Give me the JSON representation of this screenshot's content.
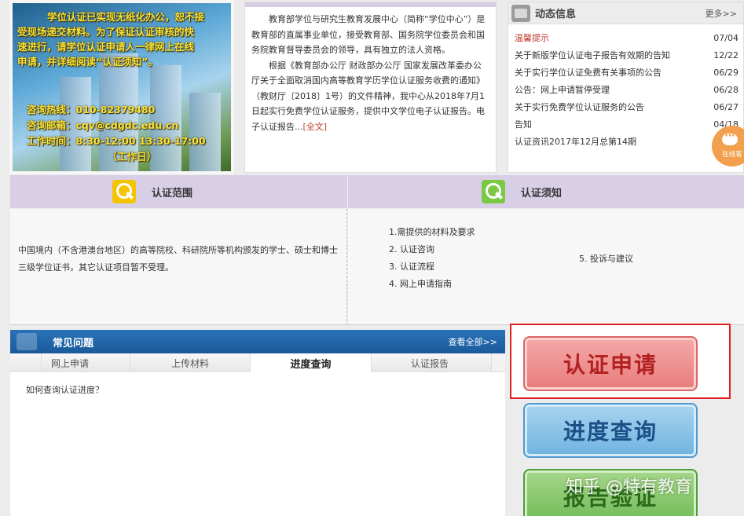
{
  "banner": {
    "line1": "学位认证已实现无纸化办公，恕不接",
    "line2": "受现场递交材料。为了保证认证审核的快",
    "line3": "速进行，请学位认证申请人一律网上在线",
    "line4": "申请，并详细阅读“认证须知”。",
    "hotline": "咨询热线：010-82379480",
    "email": "咨询邮箱：cqv@cdgdc.edu.cn",
    "hours": "工作时间：8:30-12:00  13:30-17:00",
    "workday": "（工作日）"
  },
  "intro": {
    "para1": "教育部学位与研究生教育发展中心（简称“学位中心”）是教育部的直属事业单位，接受教育部、国务院学位委员会和国务院教育督导委员会的领导，具有独立的法人资格。",
    "para2": "根据《教育部办公厅 财政部办公厅 国家发展改革委办公厅关于全面取消国内高等教育学历学位认证服务收费的通知》（教财厅〔2018〕1号）的文件精神，我中心从2018年7月1日起实行免费学位认证服务，提供中文学位电子认证报告。电子认证报告...",
    "full_link": "[全文]"
  },
  "news": {
    "title": "动态信息",
    "more": "更多>>",
    "items": [
      {
        "text": "温馨提示",
        "date": "07/04"
      },
      {
        "text": "关于新版学位认证电子报告有效期的告知",
        "date": "12/22"
      },
      {
        "text": "关于实行学位认证免费有关事项的公告",
        "date": "06/29"
      },
      {
        "text": "公告：网上申请暂停受理",
        "date": "06/28"
      },
      {
        "text": "关于实行免费学位认证服务的公告",
        "date": "06/27"
      },
      {
        "text": "告知",
        "date": "04/18"
      },
      {
        "text": "认证资讯2017年12月总第14期",
        "date": ""
      }
    ]
  },
  "online": {
    "label": "在线客"
  },
  "scope": {
    "title": "认证范围",
    "text": "中国境内（不含港澳台地区）的高等院校、科研院所等机构颁发的学士、硕士和博士三级学位证书，其它认证项目暂不受理。"
  },
  "notice": {
    "title": "认证须知",
    "items": [
      "1.需提供的材料及要求",
      "2. 认证咨询",
      "3. 认证流程",
      "4. 网上申请指南"
    ],
    "extra": "5. 投诉与建议"
  },
  "faq": {
    "title": "常见问题",
    "more": "查看全部>>",
    "tabs": [
      "网上申请",
      "上传材料",
      "进度查询",
      "认证报告"
    ],
    "question": "如何查询认证进度？"
  },
  "buttons": {
    "apply": "认证申请",
    "progress": "进度查询",
    "verify": "报告验证"
  },
  "watermark": "知乎 @特有教育"
}
